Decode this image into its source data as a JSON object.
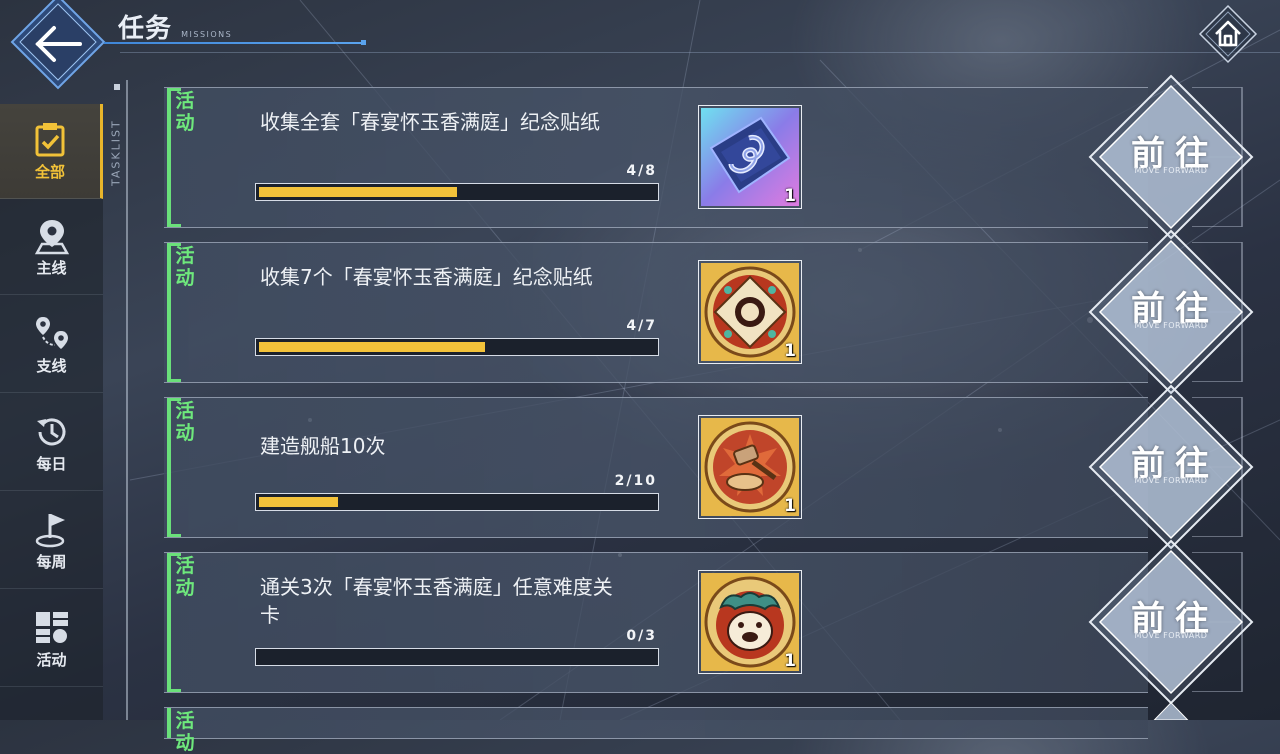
{
  "header": {
    "title": "任务",
    "subtitle": "MISSIONS"
  },
  "sidebar": {
    "rail_label": "TASKLIST",
    "items": [
      {
        "label": "全部",
        "icon": "clipboard-check-icon",
        "active": true
      },
      {
        "label": "主线",
        "icon": "map-pin-icon",
        "active": false
      },
      {
        "label": "支线",
        "icon": "route-icon",
        "active": false
      },
      {
        "label": "每日",
        "icon": "clock-history-icon",
        "active": false
      },
      {
        "label": "每周",
        "icon": "flag-icon",
        "active": false
      },
      {
        "label": "活动",
        "icon": "activity-grid-icon",
        "active": false
      }
    ]
  },
  "missions": [
    {
      "tag": "活动",
      "description": "收集全套「春宴怀玉香满庭」纪念贴纸",
      "progress_text": "4/8",
      "progress": 0.5,
      "reward_icon": "sticker-pack-icon",
      "reward_qty": "1",
      "button_cn": "前往",
      "button_en": "MOVE FORWARD"
    },
    {
      "tag": "活动",
      "description": "收集7个「春宴怀玉香满庭」纪念贴纸",
      "progress_text": "4/7",
      "progress": 0.571,
      "reward_icon": "medal-badge-icon",
      "reward_qty": "1",
      "button_cn": "前往",
      "button_en": "MOVE FORWARD"
    },
    {
      "tag": "活动",
      "description": "建造舰船10次",
      "progress_text": "2/10",
      "progress": 0.2,
      "reward_icon": "hammer-medal-icon",
      "reward_qty": "1",
      "button_cn": "前往",
      "button_en": "MOVE FORWARD"
    },
    {
      "tag": "活动",
      "description": "通关3次「春宴怀玉香满庭」任意难度关卡",
      "progress_text": "0/3",
      "progress": 0.0,
      "reward_icon": "mask-medal-icon",
      "reward_qty": "1",
      "button_cn": "前往",
      "button_en": "MOVE FORWARD"
    }
  ],
  "colors": {
    "accent_green": "#6ae07a",
    "progress_yellow": "#f3c23a",
    "active_tab": "#e8b52b",
    "title_underline": "#3f86d8"
  }
}
